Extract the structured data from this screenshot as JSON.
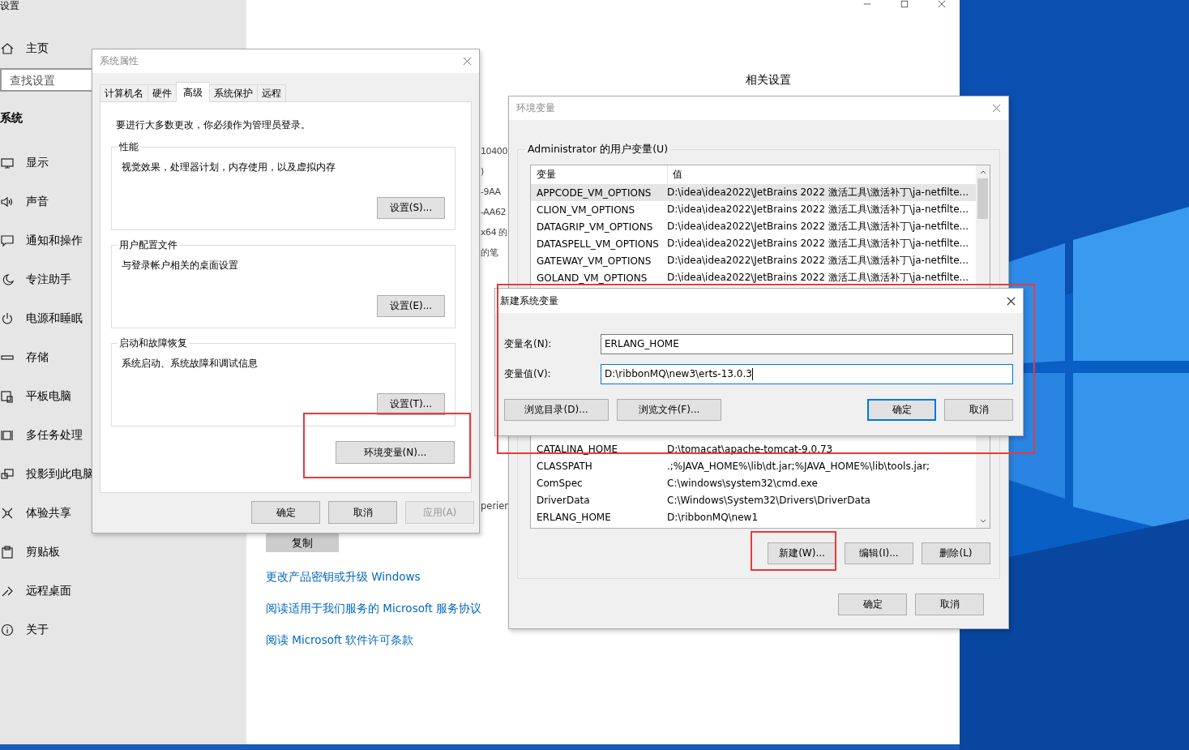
{
  "settings": {
    "title": "设置",
    "home": "主页",
    "search_placeholder": "查找设置",
    "section": "系统",
    "nav": [
      {
        "label": "显示",
        "kind": "monitor"
      },
      {
        "label": "声音",
        "kind": "speaker"
      },
      {
        "label": "通知和操作",
        "kind": "bubble"
      },
      {
        "label": "专注助手",
        "kind": "moon"
      },
      {
        "label": "电源和睡眠",
        "kind": "power"
      },
      {
        "label": "存储",
        "kind": "drive"
      },
      {
        "label": "平板电脑",
        "kind": "tablet"
      },
      {
        "label": "多任务处理",
        "kind": "multitask"
      },
      {
        "label": "投影到此电脑",
        "kind": "project"
      },
      {
        "label": "体验共享",
        "kind": "nodes"
      },
      {
        "label": "剪贴板",
        "kind": "clipboard"
      },
      {
        "label": "远程桌面",
        "kind": "chevrons"
      },
      {
        "label": "关于",
        "kind": "info"
      }
    ],
    "related": "相关设置",
    "peek_texts": [
      "10400",
      ")",
      "-9AA",
      "-AA62",
      "x64 的",
      "的笔"
    ],
    "peek_bottom": "perien",
    "copy_button": "复制",
    "links": [
      "更改产品密钥或升级 Windows",
      "阅读适用于我们服务的 Microsoft 服务协议",
      "阅读 Microsoft 软件许可条款"
    ]
  },
  "system_properties": {
    "title": "系统属性",
    "tabs": [
      {
        "label": "计算机名",
        "selected": false
      },
      {
        "label": "硬件",
        "selected": false
      },
      {
        "label": "高级",
        "selected": true
      },
      {
        "label": "系统保护",
        "selected": false
      },
      {
        "label": "远程",
        "selected": false
      }
    ],
    "notice": "要进行大多数更改，你必须作为管理员登录。",
    "groups": [
      {
        "legend": "性能",
        "description": "视觉效果，处理器计划，内存使用，以及虚拟内存",
        "button": "设置(S)..."
      },
      {
        "legend": "用户配置文件",
        "description": "与登录帐户相关的桌面设置",
        "button": "设置(E)..."
      },
      {
        "legend": "启动和故障恢复",
        "description": "系统启动、系统故障和调试信息",
        "button": "设置(T)..."
      }
    ],
    "env_button": {
      "label": "环境变量(N)...",
      "highlighted": true
    },
    "buttons": [
      {
        "label": "确定",
        "disabled": false
      },
      {
        "label": "取消",
        "disabled": false
      },
      {
        "label": "应用(A)",
        "disabled": true
      }
    ]
  },
  "env_vars": {
    "title": "环境变量",
    "group_label": "Administrator 的用户变量(U)",
    "columns": [
      "变量",
      "值"
    ],
    "rows": [
      {
        "name": "APPCODE_VM_OPTIONS",
        "value": "D:\\idea\\idea2022\\JetBrains 2022 激活工具\\激活补丁\\ja-netfilte...",
        "selected": true
      },
      {
        "name": "CLION_VM_OPTIONS",
        "value": "D:\\idea\\idea2022\\JetBrains 2022 激活工具\\激活补丁\\ja-netfilte...",
        "selected": false
      },
      {
        "name": "DATAGRIP_VM_OPTIONS",
        "value": "D:\\idea\\idea2022\\JetBrains 2022 激活工具\\激活补丁\\ja-netfilte...",
        "selected": false
      },
      {
        "name": "DATASPELL_VM_OPTIONS",
        "value": "D:\\idea\\idea2022\\JetBrains 2022 激活工具\\激活补丁\\ja-netfilte...",
        "selected": false
      },
      {
        "name": "GATEWAY_VM_OPTIONS",
        "value": "D:\\idea\\idea2022\\JetBrains 2022 激活工具\\激活补丁\\ja-netfilte...",
        "selected": false
      },
      {
        "name": "GOLAND_VM_OPTIONS",
        "value": "D:\\idea\\idea2022\\JetBrains 2022 激活工具\\激活补丁\\ja-netfilte...",
        "selected": false
      }
    ],
    "more_rows": [
      {
        "name": "CATALINA_HOME",
        "value": "D:\\tomacat\\apache-tomcat-9.0.73",
        "selected": false
      },
      {
        "name": "CLASSPATH",
        "value": ".;%JAVA_HOME%\\lib\\dt.jar;%JAVA_HOME%\\lib\\tools.jar;",
        "selected": false
      },
      {
        "name": "ComSpec",
        "value": "C:\\windows\\system32\\cmd.exe",
        "selected": false
      },
      {
        "name": "DriverData",
        "value": "C:\\Windows\\System32\\Drivers\\DriverData",
        "selected": false
      },
      {
        "name": "ERLANG_HOME",
        "value": "D:\\ribbonMQ\\new1",
        "selected": false
      }
    ],
    "list_buttons": [
      {
        "label": "新建(W)...",
        "highlighted": true
      },
      {
        "label": "编辑(I)...",
        "highlighted": false
      },
      {
        "label": "删除(L)",
        "highlighted": false
      }
    ],
    "buttons": [
      "确定",
      "取消"
    ]
  },
  "new_variable": {
    "title": "新建系统变量",
    "highlighted": true,
    "fields": [
      {
        "label": "变量名(N):",
        "value": "ERLANG_HOME",
        "focused": false
      },
      {
        "label": "变量值(V):",
        "value": "D:\\ribbonMQ\\new3\\erts-13.0.3",
        "focused": true
      }
    ],
    "browse_buttons": [
      "浏览目录(D)...",
      "浏览文件(F)..."
    ],
    "buttons": [
      {
        "label": "确定",
        "default": true
      },
      {
        "label": "取消",
        "default": false
      }
    ]
  }
}
